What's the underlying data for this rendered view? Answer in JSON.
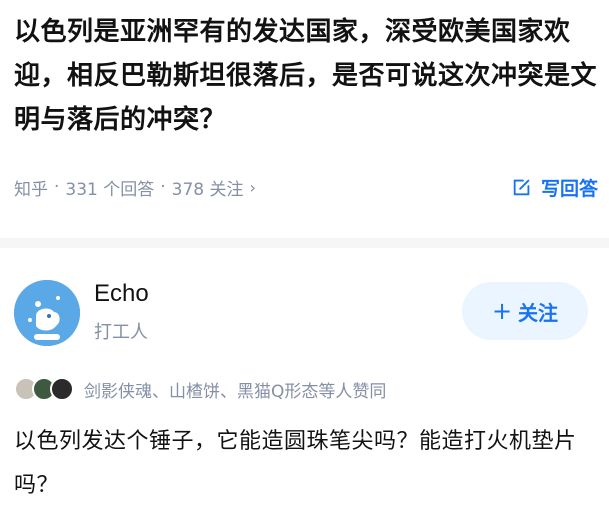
{
  "question": {
    "title": "以色列是亚洲罕有的发达国家，深受欧美国家欢迎，相反巴勒斯坦很落后，是否可说这次冲突是文明与落后的冲突？",
    "source": "知乎",
    "answers_count": "331 个回答",
    "followers_count": "378 关注",
    "write_answer_label": "写回答"
  },
  "answer": {
    "author_name": "Echo",
    "author_bio": "打工人",
    "follow_label": "关注",
    "likers_text": "剑影侠魂、山楂饼、黑猫Q形态等人赞同",
    "content": "以色列发达个锤子，它能造圆珠笔尖吗？能造打火机垫片吗？"
  },
  "colors": {
    "accent": "#1772f6",
    "follow_bg": "#ebf5ff",
    "meta_gray": "#8590a6",
    "avatar_blue": "#5ba8e6"
  }
}
